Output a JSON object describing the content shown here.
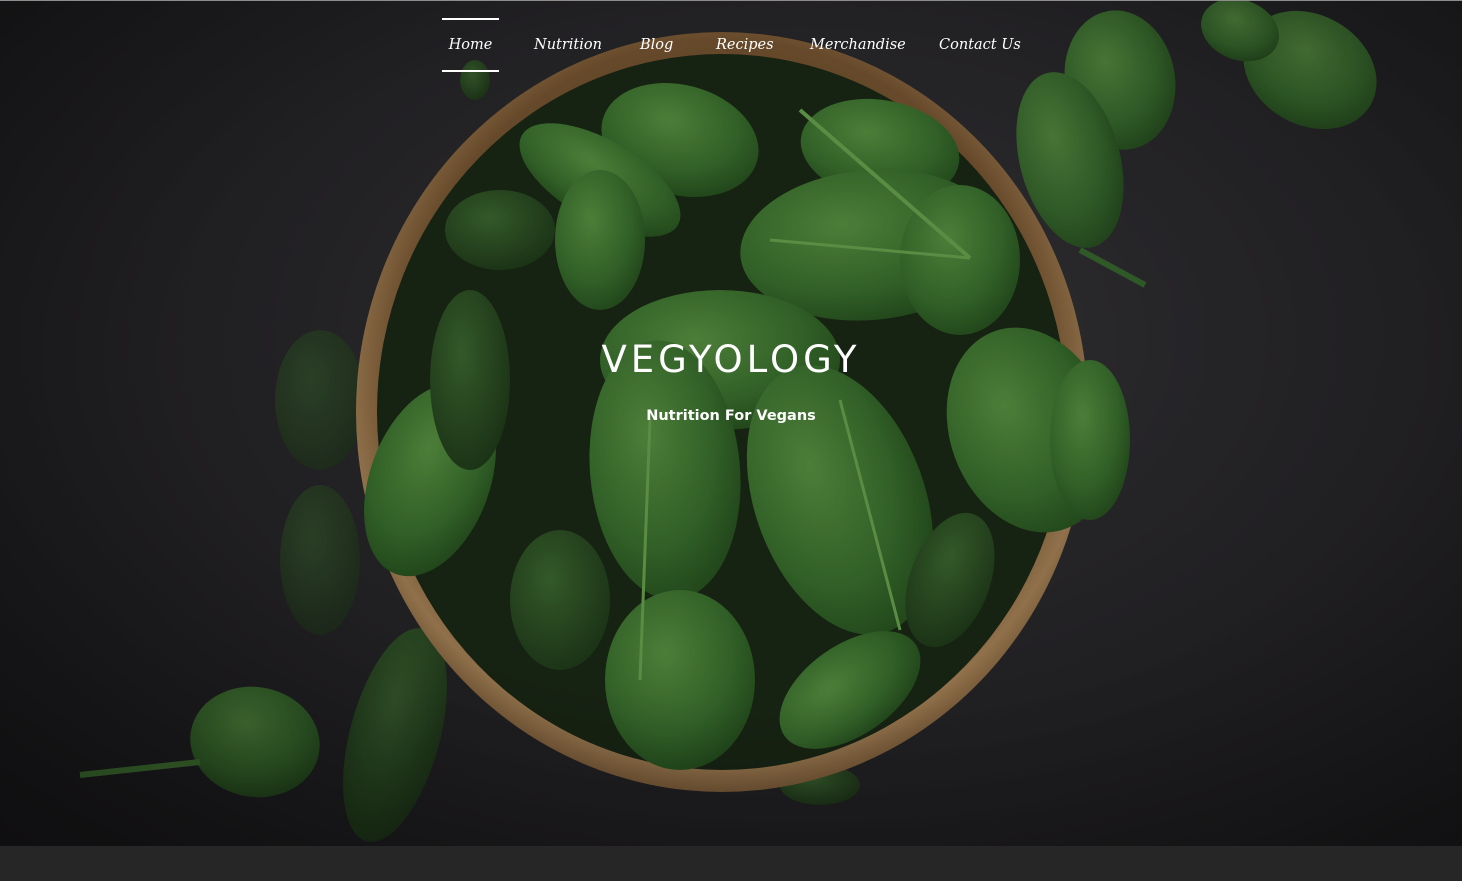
{
  "nav": {
    "items": [
      {
        "label": "Home",
        "active": true
      },
      {
        "label": "Nutrition",
        "active": false
      },
      {
        "label": "Blog",
        "active": false
      },
      {
        "label": "Recipes",
        "active": false
      },
      {
        "label": "Merchandise",
        "active": false
      },
      {
        "label": "Contact Us",
        "active": false
      }
    ]
  },
  "hero": {
    "title": "VEGYOLOGY",
    "tagline": "Nutrition For Vegans"
  },
  "colors": {
    "background": "#2a292c",
    "text": "#ffffff",
    "leaf": "#3f7a33",
    "bowl": "#b0865a"
  }
}
